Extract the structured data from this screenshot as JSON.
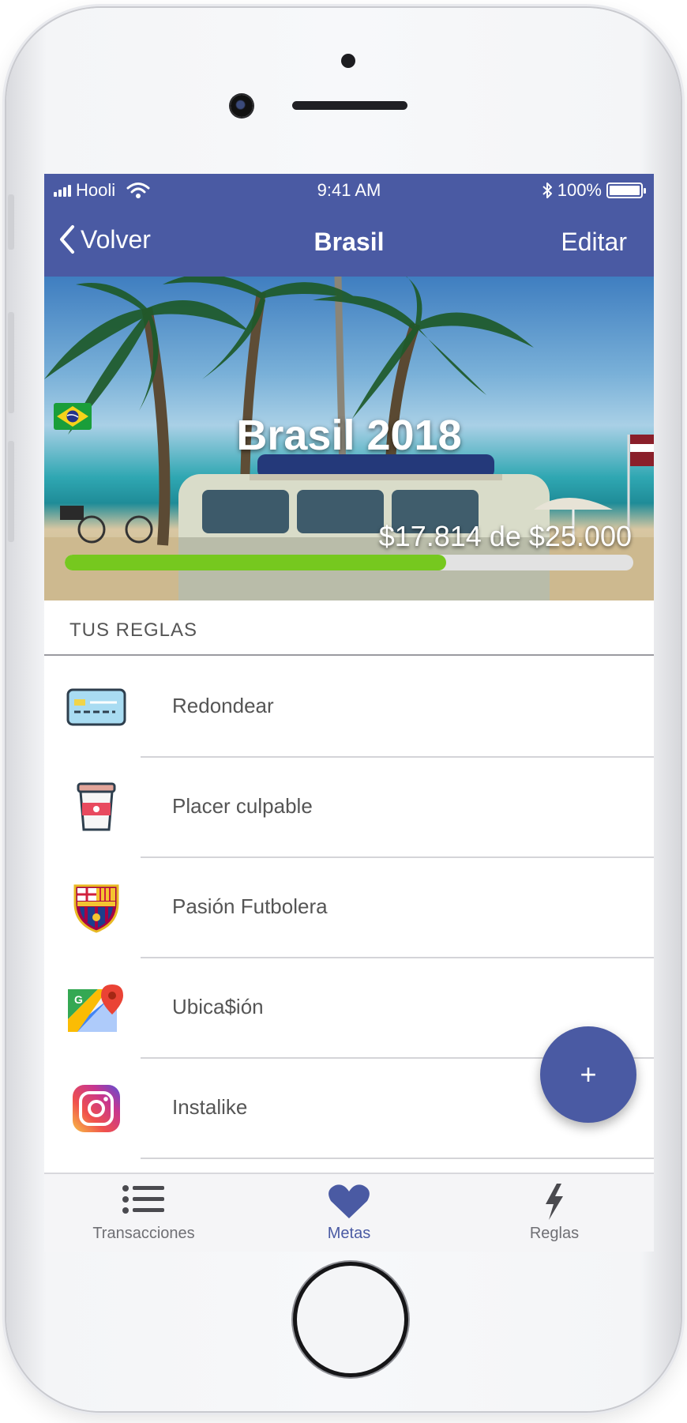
{
  "status_bar": {
    "carrier": "Hooli",
    "time": "9:41 AM",
    "battery": "100%",
    "battery_level": 1.0
  },
  "nav": {
    "back_label": "Volver",
    "title": "Brasil",
    "edit_label": "Editar"
  },
  "goal": {
    "title": "Brasil 2018",
    "flag_icon": "brazil-flag-icon",
    "amount_text": "$17.814 de $25.000",
    "saved": 17814,
    "target": 25000,
    "progress_fraction": 0.6708,
    "progress_color": "#76c81f"
  },
  "rules_section": {
    "header": "TUS REGLAS",
    "rules": [
      {
        "label": "Redondear",
        "icon": "credit-card-icon"
      },
      {
        "label": "Placer culpable",
        "icon": "coffee-cup-icon"
      },
      {
        "label": "Pasión Futbolera",
        "icon": "fc-barcelona-crest-icon"
      },
      {
        "label": "Ubica$ión",
        "icon": "google-maps-icon"
      },
      {
        "label": "Instalike",
        "icon": "instagram-icon"
      }
    ]
  },
  "fab": {
    "label": "+"
  },
  "tabs": [
    {
      "label": "Transacciones",
      "icon": "list-icon",
      "active": false
    },
    {
      "label": "Metas",
      "icon": "heart-icon",
      "active": true
    },
    {
      "label": "Reglas",
      "icon": "lightning-icon",
      "active": false
    }
  ],
  "colors": {
    "primary": "#4a5aa3",
    "progress": "#76c81f",
    "text_muted": "#555555"
  }
}
